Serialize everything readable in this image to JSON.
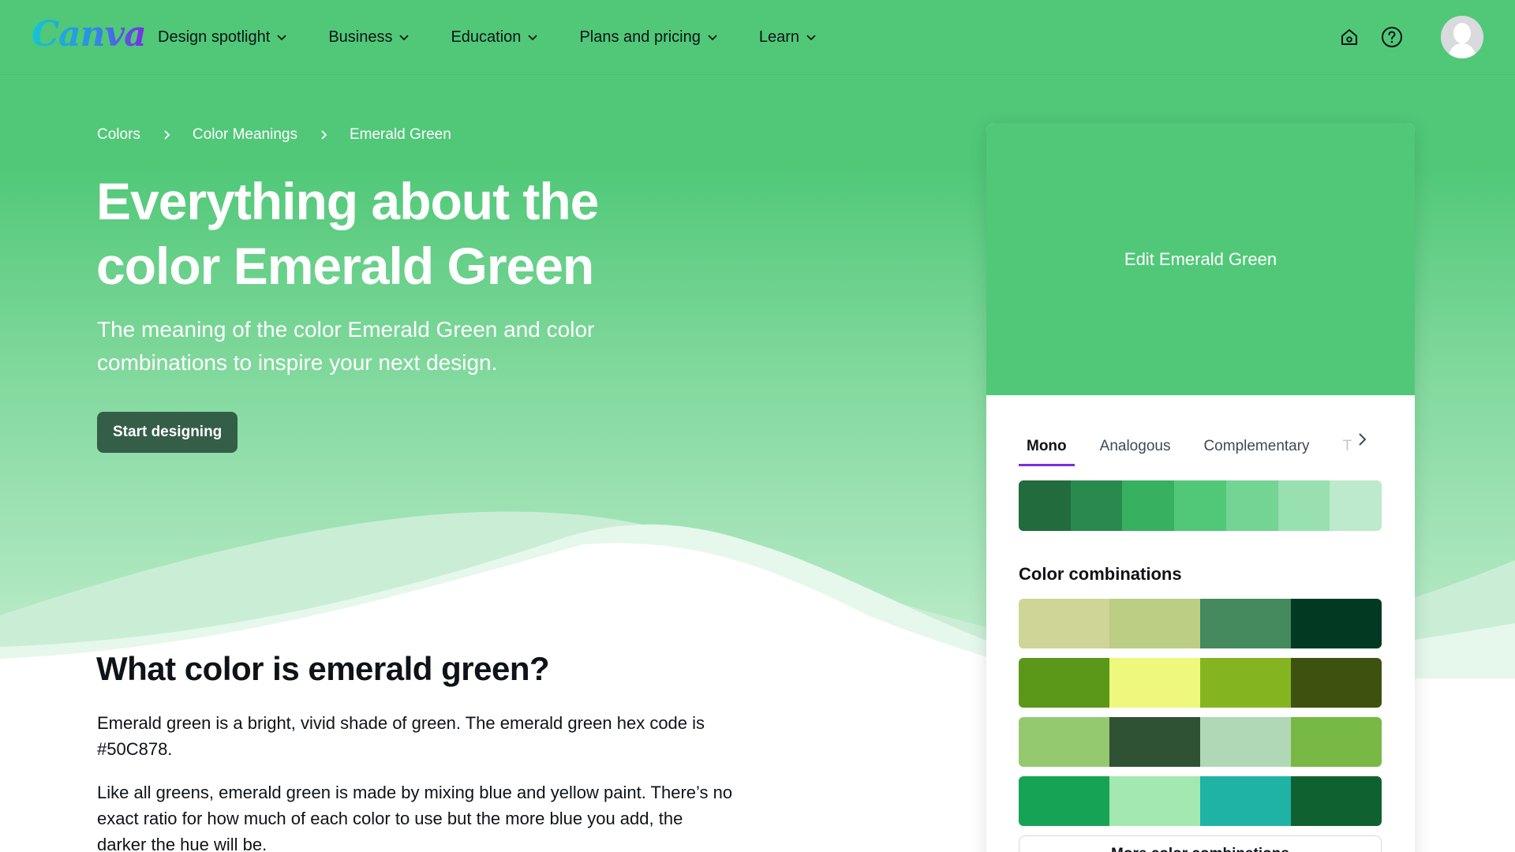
{
  "header": {
    "logo_text": "Canva",
    "nav": [
      {
        "label": "Design spotlight"
      },
      {
        "label": "Business"
      },
      {
        "label": "Education"
      },
      {
        "label": "Plans and pricing"
      },
      {
        "label": "Learn"
      }
    ]
  },
  "breadcrumb": [
    "Colors",
    "Color Meanings",
    "Emerald Green"
  ],
  "hero": {
    "title": "Everything about the color Emerald Green",
    "subtitle": "The meaning of the color Emerald Green and color combinations to inspire your next design.",
    "cta": "Start designing"
  },
  "article": {
    "heading": "What color is emerald green?",
    "paragraphs": [
      "Emerald green is a bright, vivid shade of green. The emerald green hex code is #50C878.",
      "Like all greens, emerald green is made by mixing blue and yellow paint. There’s no exact ratio for how much of each color to use but the more blue you add, the darker the hue will be."
    ]
  },
  "card": {
    "edit_label": "Edit Emerald Green",
    "preview_color": "#50C878",
    "tabs": [
      "Mono",
      "Analogous",
      "Complementary",
      "T"
    ],
    "active_tab": "Mono",
    "mono_swatches": [
      "#216b3d",
      "#2a8a4e",
      "#37b060",
      "#50c878",
      "#73d493",
      "#98e0b0",
      "#bde9cc"
    ],
    "combinations_title": "Color combinations",
    "combinations": [
      [
        "#cfd497",
        "#bccd84",
        "#458a5e",
        "#023923"
      ],
      [
        "#5b9819",
        "#eef87d",
        "#84b521",
        "#3d520f"
      ],
      [
        "#95c970",
        "#2e5233",
        "#b1d8b6",
        "#77b944"
      ],
      [
        "#17a355",
        "#a3e8b1",
        "#1fb3a6",
        "#0f6130"
      ]
    ],
    "more_button": "More color combinations"
  },
  "colors": {
    "brand": "#50c878",
    "cta_bg": "#355e49",
    "tab_underline": "#7d2ae8"
  }
}
